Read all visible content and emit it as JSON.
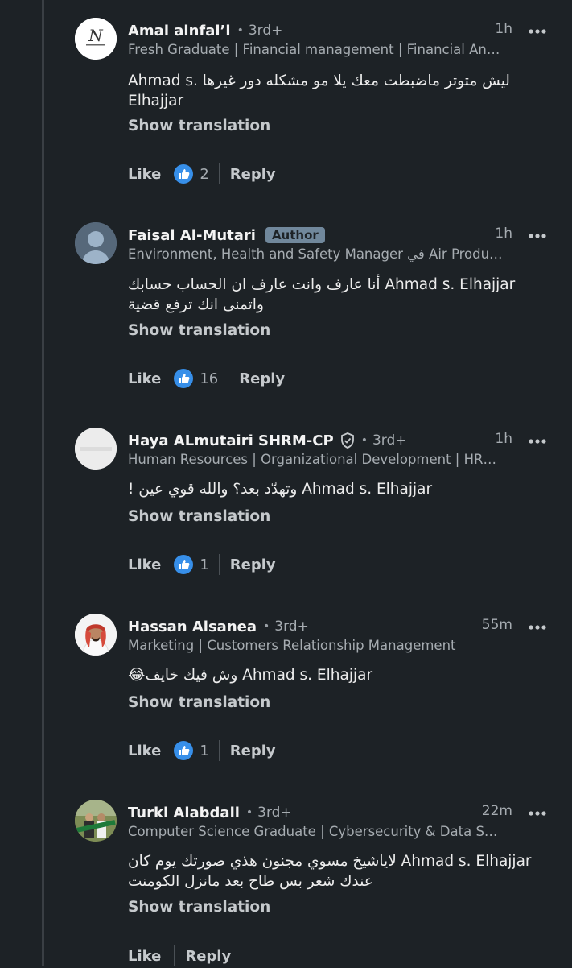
{
  "comments": [
    {
      "name": "Amal alnfai’i",
      "degree": "3rd+",
      "time": "1h",
      "headline": "Fresh Graduate | Financial management | Financial An…",
      "text": "ليش متوتر ماضبطت معك يلا مو مشكله دور غيرها Ahmad s. Elhajjar",
      "show_translation": "Show translation",
      "like_label": "Like",
      "like_count": "2",
      "reply_label": "Reply",
      "avatar": "logo-icon"
    },
    {
      "name": "Faisal Al-Mutari",
      "author_badge": "Author",
      "time": "1h",
      "headline": "Environment, Health and Safety Manager في Air Produ…",
      "text": "Ahmad s. Elhajjar أنا عارف وانت عارف ان الحساب حسابك واتمنى انك ترفع قضية",
      "show_translation": "Show translation",
      "like_label": "Like",
      "like_count": "16",
      "reply_label": "Reply",
      "avatar": "default-person-icon"
    },
    {
      "name": "Haya ALmutairi SHRM-CP",
      "degree": "3rd+",
      "time": "1h",
      "headline": "Human Resources | Organizational Development | HR…",
      "text": "Ahmad s. Elhajjar وتهدّد بعد؟ والله قوي عين !",
      "show_translation": "Show translation",
      "like_label": "Like",
      "like_count": "1",
      "reply_label": "Reply",
      "avatar": "blank-avatar"
    },
    {
      "name": "Hassan Alsanea",
      "degree": "3rd+",
      "time": "55m",
      "headline": "Marketing | Customers Relationship Management",
      "text": "Ahmad s. Elhajjar وش فيك خايف😂",
      "show_translation": "Show translation",
      "like_label": "Like",
      "like_count": "1",
      "reply_label": "Reply",
      "avatar": "person-photo"
    },
    {
      "name": "Turki Alabdali",
      "degree": "3rd+",
      "time": "22m",
      "headline": "Computer Science Graduate | Cybersecurity & Data S…",
      "text": "Ahmad s. Elhajjar  لاياشيخ مسوي مجنون هذي صورتك يوم كان عندك شعر بس طاح بعد مانزل الكومنت",
      "show_translation": "Show translation",
      "like_label": "Like",
      "reply_label": "Reply",
      "avatar": "group-photo"
    }
  ],
  "colors": {
    "background": "#1d2226",
    "like_blue": "#378fe9",
    "author_badge": "#71889c"
  }
}
